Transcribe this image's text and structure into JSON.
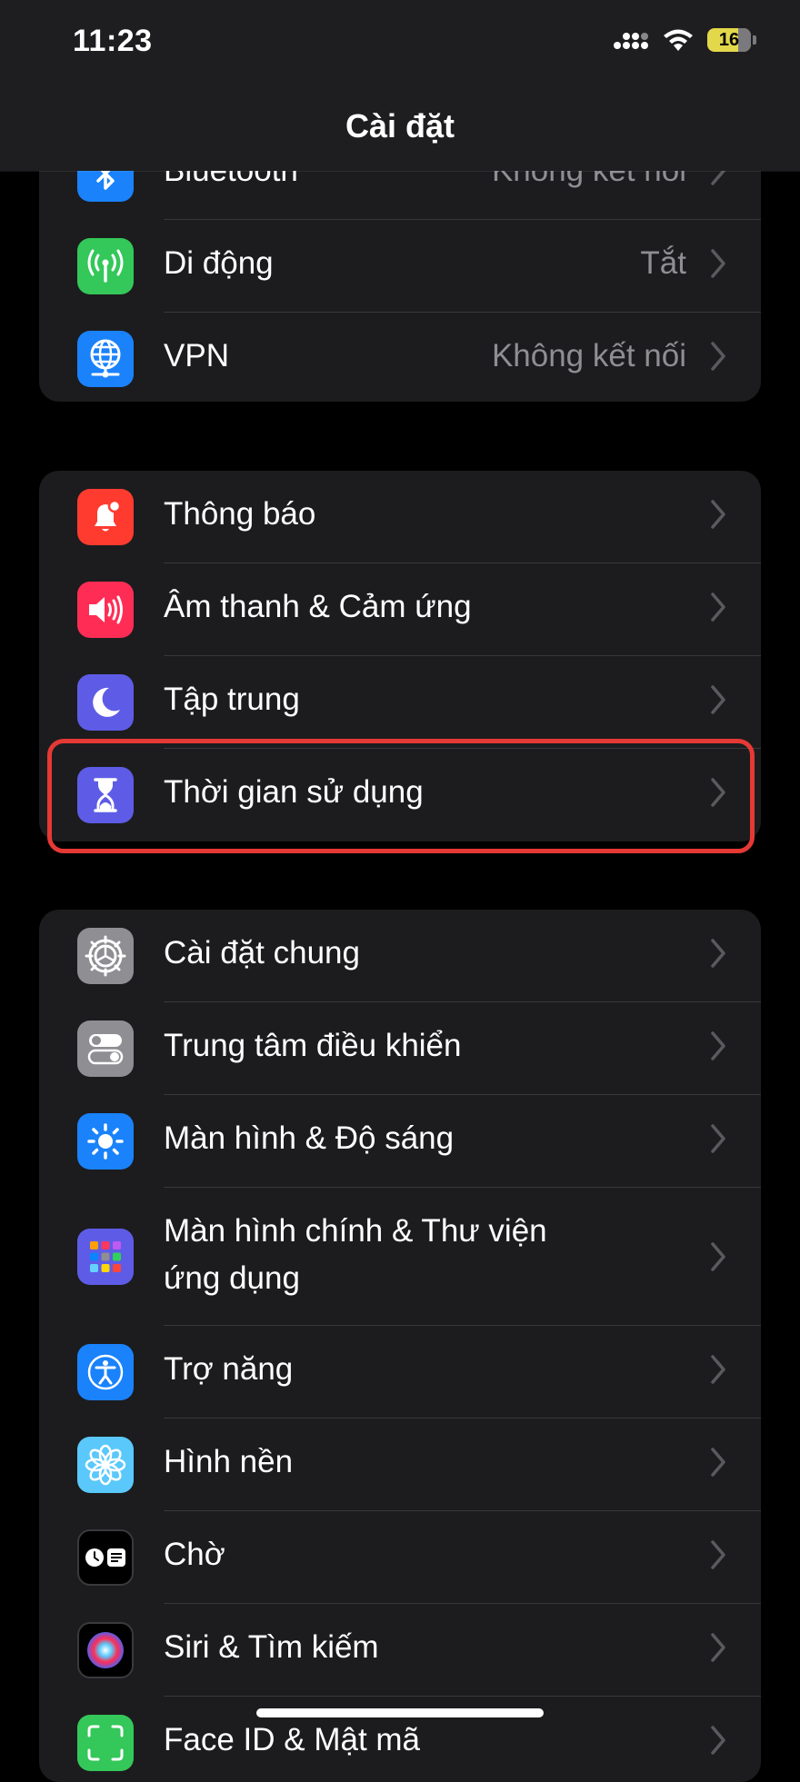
{
  "status": {
    "time": "11:23",
    "battery": "16"
  },
  "header": {
    "title": "Cài đặt"
  },
  "groups": {
    "network": [
      {
        "label": "Bluetooth",
        "value": "Không kết nối"
      },
      {
        "label": "Di động",
        "value": "Tắt"
      },
      {
        "label": "VPN",
        "value": "Không kết nối"
      }
    ],
    "alerts": [
      {
        "label": "Thông báo"
      },
      {
        "label": "Âm thanh & Cảm ứng"
      },
      {
        "label": "Tập trung"
      },
      {
        "label": "Thời gian sử dụng"
      }
    ],
    "general": [
      {
        "label": "Cài đặt chung"
      },
      {
        "label": "Trung tâm điều khiển"
      },
      {
        "label": "Màn hình & Độ sáng"
      },
      {
        "label": "Màn hình chính & Thư viện",
        "label2": "ứng dụng"
      },
      {
        "label": "Trợ năng"
      },
      {
        "label": "Hình nền"
      },
      {
        "label": "Chờ"
      },
      {
        "label": "Siri & Tìm kiếm"
      },
      {
        "label": "Face ID & Mật mã"
      }
    ]
  },
  "colors": {
    "bluetooth": "#1a82fb",
    "cellular": "#34c759",
    "vpn": "#1a82fb",
    "notifications": "#ff3b30",
    "sounds": "#ff2d55",
    "focus": "#5e5ce6",
    "screentime": "#5e5ce6",
    "general": "#8e8e93",
    "control": "#8e8e93",
    "display": "#1a82fb",
    "homescreen": "#5e5ce6",
    "accessibility": "#1a82fb",
    "wallpaper": "#5ac8fa",
    "standby": "#000000",
    "faceid": "#34c759",
    "highlight": "#e53935"
  }
}
